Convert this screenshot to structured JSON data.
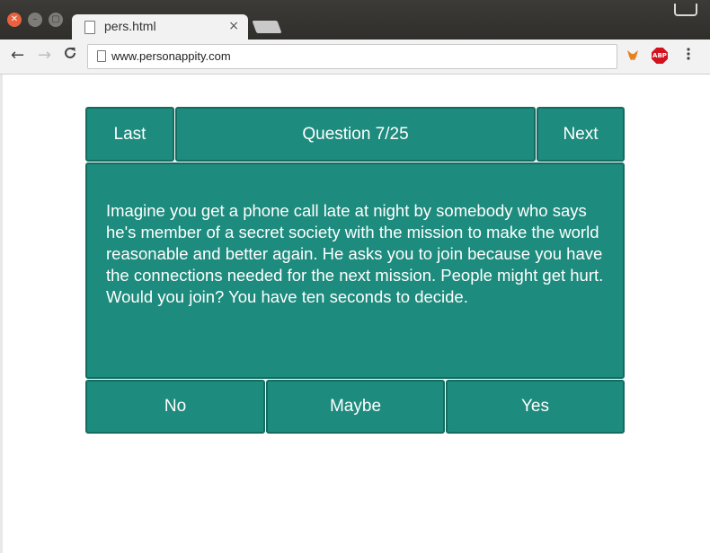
{
  "browser": {
    "tab": {
      "title": "pers.html",
      "close": "×"
    },
    "address_bar": {
      "url": "www.personappity.com"
    },
    "extensions": {
      "abp_label": "ABP"
    },
    "nav": {
      "back": "←",
      "forward": "→",
      "reload": "C",
      "menu": "⋮"
    }
  },
  "quiz": {
    "last_label": "Last",
    "question_label": "Question 7/25",
    "next_label": "Next",
    "question_text": "Imagine you get a phone call late at night by somebody who says he's member of a secret society with the mission to make the world reasonable and better again. He asks you to join because you have the connections needed for the next mission. People might get hurt. Would you join? You have ten seconds to decide.",
    "answers": [
      {
        "label": "No"
      },
      {
        "label": "Maybe"
      },
      {
        "label": "Yes"
      }
    ]
  },
  "colors": {
    "tile": "#1d8b7d",
    "tile_border": "#146b60",
    "titlebar": "#3c3b37",
    "close_button": "#e9613e"
  },
  "icons": [
    "close-window-icon",
    "minimize-icon",
    "maximize-icon",
    "page-icon",
    "back-arrow-icon",
    "forward-arrow-icon",
    "reload-icon",
    "metamask-fox-icon",
    "adblock-icon",
    "kebab-menu-icon"
  ]
}
